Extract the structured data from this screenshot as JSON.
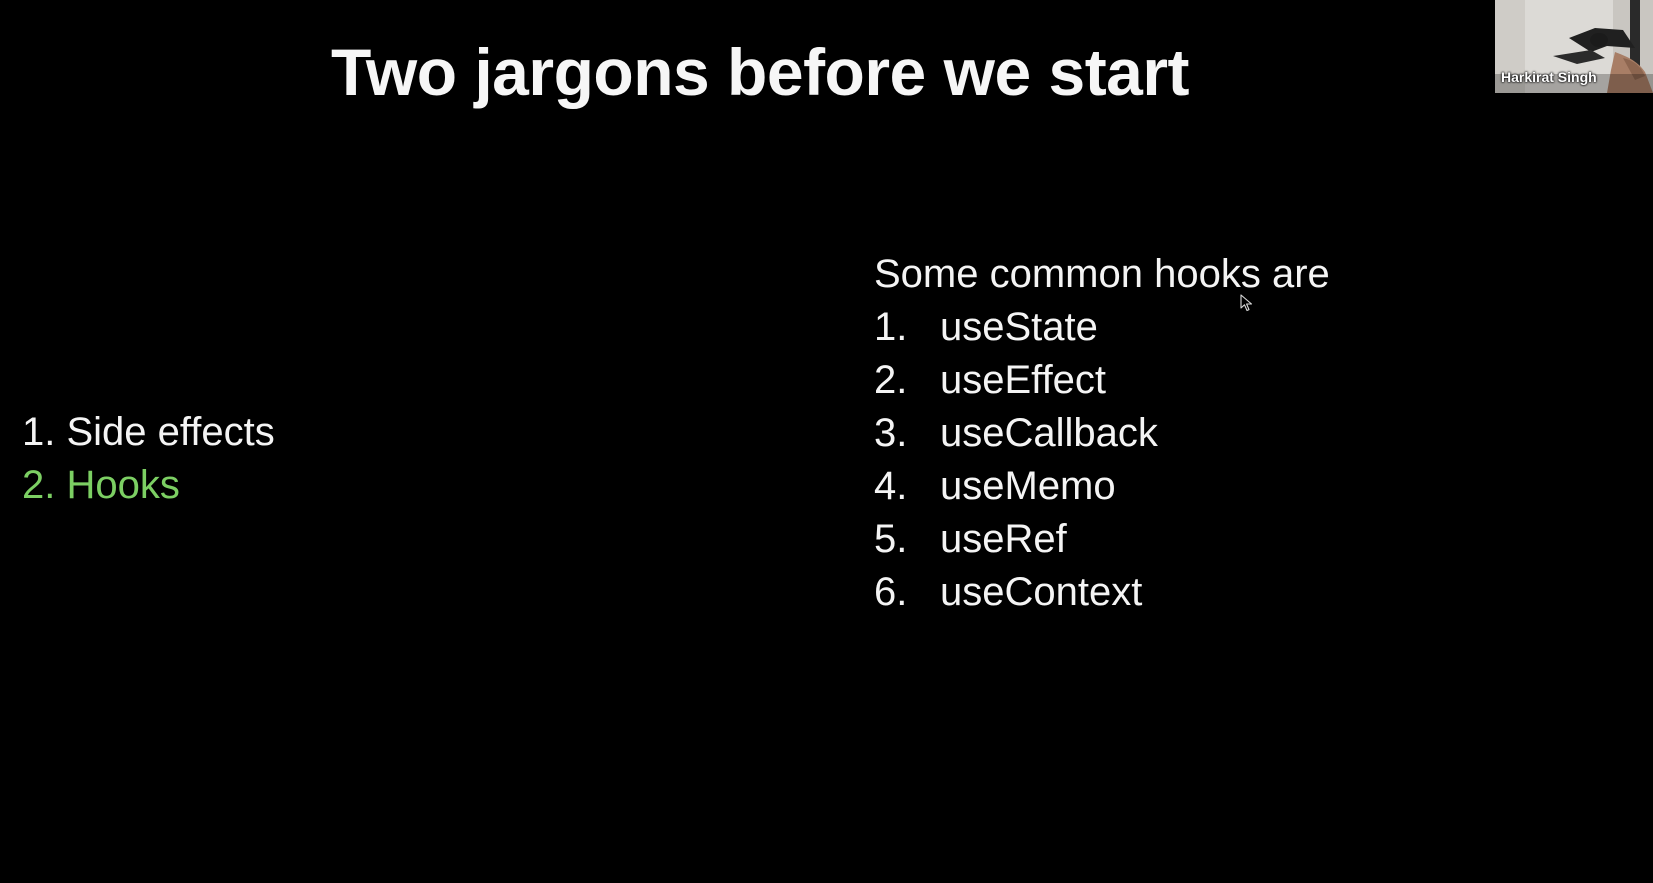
{
  "slide": {
    "title": "Two jargons before we start",
    "left_items": [
      {
        "label": "1. Side effects",
        "highlighted": false
      },
      {
        "label": "2. Hooks",
        "highlighted": true
      }
    ],
    "right_heading": "Some common hooks are",
    "hooks": [
      {
        "num": "1.",
        "label": "useState"
      },
      {
        "num": "2.",
        "label": "useEffect"
      },
      {
        "num": "3.",
        "label": "useCallback"
      },
      {
        "num": "4.",
        "label": "useMemo"
      },
      {
        "num": "5.",
        "label": "useRef"
      },
      {
        "num": "6.",
        "label": "useContext"
      }
    ]
  },
  "webcam": {
    "participant_name": "Harkirat Singh"
  },
  "colors": {
    "background": "#000000",
    "text": "#f4f4f4",
    "highlight": "#7ccf63"
  },
  "icons": {
    "cursor": "mouse-pointer-icon"
  }
}
